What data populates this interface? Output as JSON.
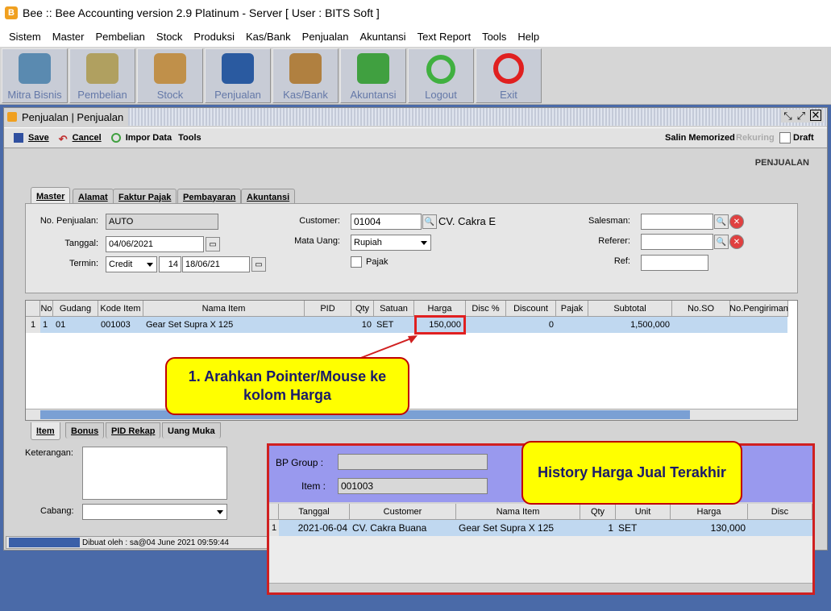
{
  "app": {
    "title": "Bee :: Bee Accounting version 2.9 Platinum - Server  [ User : BITS Soft ]",
    "logo": "B"
  },
  "menu": [
    "Sistem",
    "Master",
    "Pembelian",
    "Stock",
    "Produksi",
    "Kas/Bank",
    "Penjualan",
    "Akuntansi",
    "Text Report",
    "Tools",
    "Help"
  ],
  "toolbar": [
    {
      "label": "Mitra Bisnis",
      "icon": "users-icon",
      "color": "#5a8ab0"
    },
    {
      "label": "Pembelian",
      "icon": "documents-icon",
      "color": "#b0a060"
    },
    {
      "label": "Stock",
      "icon": "boxes-icon",
      "color": "#c0904a"
    },
    {
      "label": "Penjualan",
      "icon": "shopping-bag-icon",
      "color": "#2a5aa0"
    },
    {
      "label": "Kas/Bank",
      "icon": "money-bag-icon",
      "color": "#b08040"
    },
    {
      "label": "Akuntansi",
      "icon": "chart-icon",
      "color": "#40a040"
    },
    {
      "label": "Logout",
      "icon": "logout-icon",
      "color": "#40b040"
    },
    {
      "label": "Exit",
      "icon": "power-icon",
      "color": "#e02020"
    }
  ],
  "window": {
    "title": "Penjualan | Penjualan",
    "heading": "PENJUALAN"
  },
  "actions": {
    "save": "Save",
    "cancel": "Cancel",
    "import": "Impor Data",
    "tools": "Tools",
    "salin": "Salin Memorized",
    "rekuring": "Rekuring",
    "draft": "Draft"
  },
  "tabs": [
    "Master",
    "Alamat",
    "Faktur Pajak",
    "Pembayaran",
    "Akuntansi"
  ],
  "form": {
    "no_label": "No. Penjualan:",
    "no_value": "AUTO",
    "tanggal_label": "Tanggal:",
    "tanggal_value": "04/06/2021",
    "termin_label": "Termin:",
    "termin_value": "Credit",
    "termin_days": "14",
    "termin_date": "18/06/21",
    "customer_label": "Customer:",
    "customer_code": "01004",
    "customer_name": "CV. Cakra E",
    "mata_uang_label": "Mata Uang:",
    "mata_uang_value": "Rupiah",
    "pajak_label": "Pajak",
    "salesman_label": "Salesman:",
    "referer_label": "Referer:",
    "ref_label": "Ref:"
  },
  "grid": {
    "headers": [
      "No",
      "Gudang",
      "Kode Item",
      "Nama Item",
      "PID",
      "Qty",
      "Satuan",
      "Harga",
      "Disc %",
      "Discount",
      "Pajak",
      "Subtotal",
      "No.SO",
      "No.Pengiriman"
    ],
    "rows": [
      {
        "rownum": "1",
        "no": "1",
        "gudang": "01",
        "kode": "001003",
        "nama": "Gear Set Supra X 125",
        "pid": "",
        "qty": "10",
        "satuan": "SET",
        "harga": "150,000",
        "disc": "",
        "discount": "0",
        "pajak": "",
        "subtotal": "1,500,000",
        "noso": "",
        "nopengiriman": ""
      }
    ]
  },
  "subtabs": [
    "Item",
    "Bonus",
    "PID Rekap",
    "Uang Muka"
  ],
  "bottom": {
    "keterangan_label": "Keterangan:",
    "cabang_label": "Cabang:",
    "status": "Dibuat oleh : sa@04 June 2021  09:59:44"
  },
  "callouts": {
    "pointer": "1. Arahkan Pointer/Mouse ke kolom Harga",
    "history": "History Harga Jual Terakhir"
  },
  "history": {
    "bp_group_label": "BP Group :",
    "bp_group_value": "",
    "item_label": "Item :",
    "item_value": "001003",
    "headers": [
      "Tanggal",
      "Customer",
      "Nama Item",
      "Qty",
      "Unit",
      "Harga",
      "Disc"
    ],
    "rows": [
      {
        "rownum": "1",
        "tanggal": "2021-06-04",
        "customer": "CV. Cakra Buana",
        "nama": "Gear Set Supra X 125",
        "qty": "1",
        "unit": "SET",
        "harga": "130,000"
      }
    ]
  }
}
